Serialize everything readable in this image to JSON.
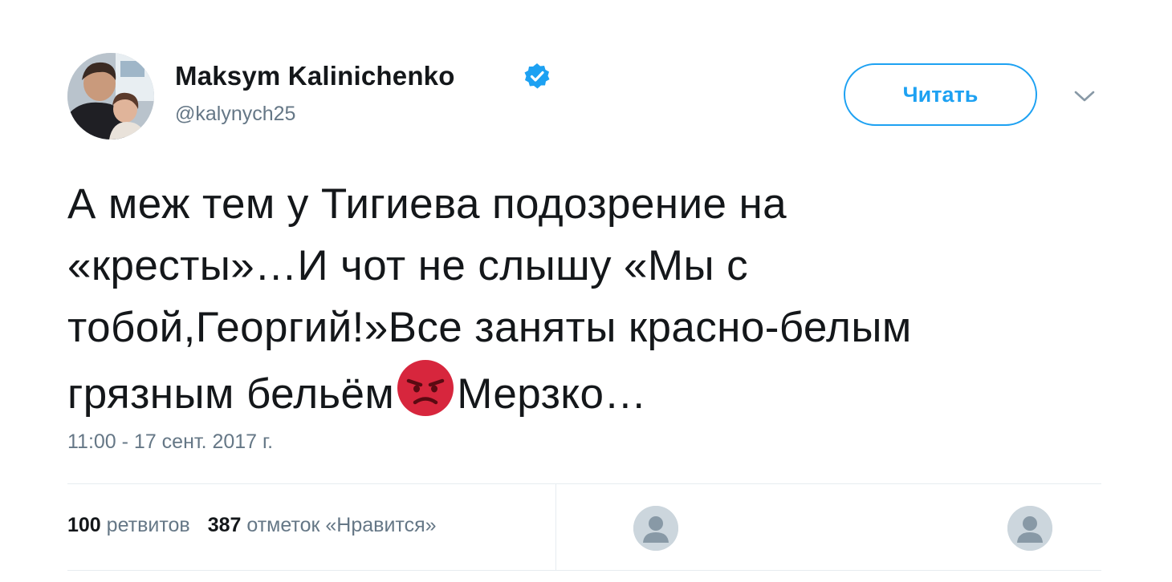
{
  "author": {
    "name": "Maksym Kalinichenko",
    "handle": "@kalynych25",
    "verified": true,
    "avatar_icon": "profile-photo"
  },
  "follow_button": {
    "label": "Читать"
  },
  "menu_icon": "chevron-down-icon",
  "tweet": {
    "lines": [
      "А меж тем у Тигиева подозрение на",
      "«кресты»…И чот не слышу «Мы с",
      "тобой,Георгий!»Все заняты красно-белым"
    ],
    "last_line_before_emoji": "грязным бельём",
    "emoji": "angry-face-emoji",
    "last_line_after_emoji": "Мерзко…"
  },
  "timestamp": "11:00 - 17 сент. 2017 г.",
  "stats": {
    "retweets_count": "100",
    "retweets_label": "ретвитов",
    "likes_count": "387",
    "likes_label": "отметок «Нравится»"
  },
  "liker_avatars": [
    "default-avatar-icon",
    "default-avatar-icon"
  ],
  "colors": {
    "accent": "#1da1f2",
    "text": "#14171a",
    "secondary_text": "#657786",
    "divider": "#e6ecf0",
    "emoji_red": "#d7263d"
  }
}
